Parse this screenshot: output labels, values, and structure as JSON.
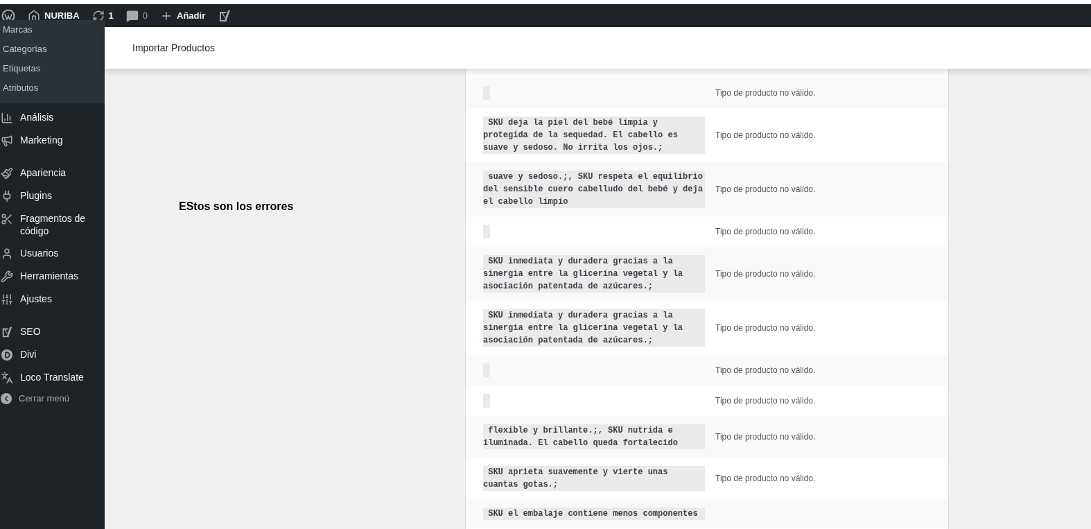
{
  "admin_bar": {
    "site": "NURIBA",
    "updates": "1",
    "comments": "0",
    "add_new": "Añadir"
  },
  "sidebar": {
    "submenu": [
      "Marcas",
      "Categorías",
      "Etiquetas",
      "Atributos"
    ],
    "groups": [
      {
        "items": [
          "Análisis",
          "Marketing"
        ]
      },
      {
        "items": [
          "Apariencia",
          "Plugins",
          "Fragmentos de código",
          "Usuarios",
          "Herramientas",
          "Ajustes"
        ]
      },
      {
        "items": [
          "SEO",
          "Divi",
          "Loco Translate"
        ]
      }
    ],
    "collapse": "Cerrar menú"
  },
  "header": {
    "title": "Importar Productos"
  },
  "note": "EStos son los errores",
  "errors": [
    {
      "message": "Tipo de producto no válido."
    },
    {
      "code": " SKU deja la piel del bebé limpia y protegida de la sequedad. El cabello es suave y sedoso. No irrita los ojos.; ",
      "message": "Tipo de producto no válido."
    },
    {
      "code": " suave y sedoso.;, SKU respeta el equilibrio del sensible cuero cabelludo del bebé y deja el cabello limpio ",
      "message": "Tipo de producto no válido."
    },
    {
      "message": "Tipo de producto no válido."
    },
    {
      "code": " SKU inmediata y duradera gracias a la sinergia entre la glicerina vegetal y la asociación patentada de azúcares.; ",
      "message": "Tipo de producto no válido."
    },
    {
      "code": " SKU inmediata y duradera gracias a la sinergia entre la glicerina vegetal y la asociación patentada de azúcares.; ",
      "message": "Tipo de producto no válido."
    },
    {
      "message": "Tipo de producto no válido."
    },
    {
      "message": "Tipo de producto no válido."
    },
    {
      "code": " flexible y brillante.;, SKU nutrida e iluminada. El cabello queda fortalecido ",
      "message": "Tipo de producto no válido."
    },
    {
      "code": " SKU aprieta suavemente y vierte unas cuantas gotas.; ",
      "message": "Tipo de producto no válido."
    },
    {
      "code": " SKU el embalaje contiene menos componentes"
    }
  ]
}
